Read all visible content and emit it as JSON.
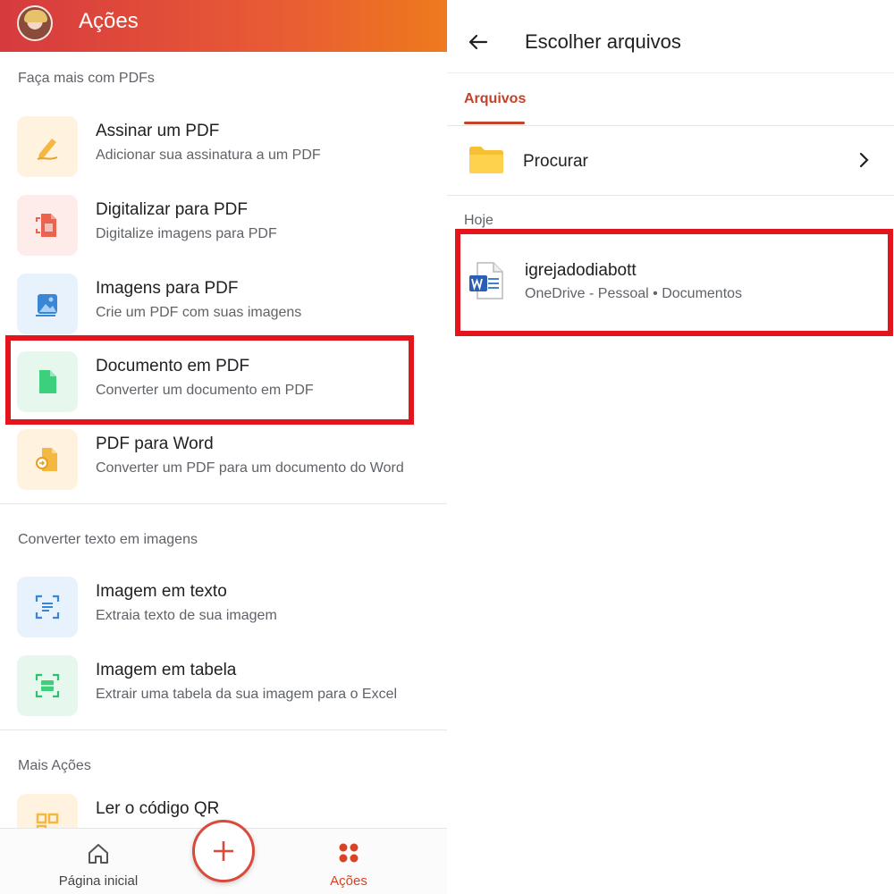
{
  "left": {
    "header": {
      "title": "Ações"
    },
    "sections": [
      {
        "title": "Faça mais com PDFs",
        "items": [
          {
            "title": "Assinar um PDF",
            "subtitle": "Adicionar sua assinatura a um PDF",
            "icon": "pen-sign-icon"
          },
          {
            "title": "Digitalizar para PDF",
            "subtitle": "Digitalize imagens para PDF",
            "icon": "scan-pdf-icon"
          },
          {
            "title": "Imagens para PDF",
            "subtitle": "Crie um PDF com suas imagens",
            "icon": "image-pdf-icon"
          },
          {
            "title": "Documento em PDF",
            "subtitle": "Converter um documento em PDF",
            "icon": "document-pdf-icon"
          },
          {
            "title": "PDF para Word",
            "subtitle": "Converter um PDF para um documento do Word",
            "icon": "pdf-word-icon"
          }
        ]
      },
      {
        "title": "Converter texto em imagens",
        "items": [
          {
            "title": "Imagem em texto",
            "subtitle": "Extraia texto de sua imagem",
            "icon": "image-text-icon"
          },
          {
            "title": "Imagem em tabela",
            "subtitle": "Extrair uma tabela da sua imagem para o Excel",
            "icon": "image-table-icon"
          }
        ]
      },
      {
        "title": "Mais Ações",
        "items": [
          {
            "title": "Ler o código QR",
            "subtitle": "",
            "icon": "qr-code-icon"
          }
        ]
      }
    ],
    "bottom_nav": {
      "home_label": "Página inicial",
      "actions_label": "Ações"
    }
  },
  "right": {
    "title": "Escolher arquivos",
    "tab": "Arquivos",
    "browse_label": "Procurar",
    "today_label": "Hoje",
    "file": {
      "name": "igrejadodiabott",
      "meta": "OneDrive - Pessoal • Documentos"
    }
  },
  "colors": {
    "header_gradient_start": "#d63a3f",
    "header_gradient_end": "#ee7a1d",
    "accent": "#c4422a",
    "highlight": "#e3141c"
  }
}
